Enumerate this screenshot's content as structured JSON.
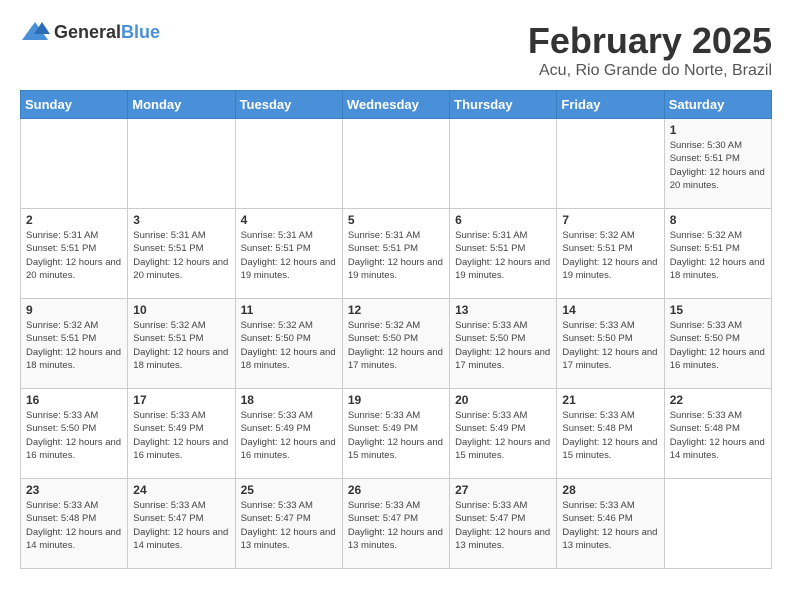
{
  "header": {
    "logo_general": "General",
    "logo_blue": "Blue",
    "title": "February 2025",
    "subtitle": "Acu, Rio Grande do Norte, Brazil"
  },
  "days_of_week": [
    "Sunday",
    "Monday",
    "Tuesday",
    "Wednesday",
    "Thursday",
    "Friday",
    "Saturday"
  ],
  "weeks": [
    [
      {
        "day": "",
        "info": ""
      },
      {
        "day": "",
        "info": ""
      },
      {
        "day": "",
        "info": ""
      },
      {
        "day": "",
        "info": ""
      },
      {
        "day": "",
        "info": ""
      },
      {
        "day": "",
        "info": ""
      },
      {
        "day": "1",
        "info": "Sunrise: 5:30 AM\nSunset: 5:51 PM\nDaylight: 12 hours and 20 minutes."
      }
    ],
    [
      {
        "day": "2",
        "info": "Sunrise: 5:31 AM\nSunset: 5:51 PM\nDaylight: 12 hours and 20 minutes."
      },
      {
        "day": "3",
        "info": "Sunrise: 5:31 AM\nSunset: 5:51 PM\nDaylight: 12 hours and 20 minutes."
      },
      {
        "day": "4",
        "info": "Sunrise: 5:31 AM\nSunset: 5:51 PM\nDaylight: 12 hours and 19 minutes."
      },
      {
        "day": "5",
        "info": "Sunrise: 5:31 AM\nSunset: 5:51 PM\nDaylight: 12 hours and 19 minutes."
      },
      {
        "day": "6",
        "info": "Sunrise: 5:31 AM\nSunset: 5:51 PM\nDaylight: 12 hours and 19 minutes."
      },
      {
        "day": "7",
        "info": "Sunrise: 5:32 AM\nSunset: 5:51 PM\nDaylight: 12 hours and 19 minutes."
      },
      {
        "day": "8",
        "info": "Sunrise: 5:32 AM\nSunset: 5:51 PM\nDaylight: 12 hours and 18 minutes."
      }
    ],
    [
      {
        "day": "9",
        "info": "Sunrise: 5:32 AM\nSunset: 5:51 PM\nDaylight: 12 hours and 18 minutes."
      },
      {
        "day": "10",
        "info": "Sunrise: 5:32 AM\nSunset: 5:51 PM\nDaylight: 12 hours and 18 minutes."
      },
      {
        "day": "11",
        "info": "Sunrise: 5:32 AM\nSunset: 5:50 PM\nDaylight: 12 hours and 18 minutes."
      },
      {
        "day": "12",
        "info": "Sunrise: 5:32 AM\nSunset: 5:50 PM\nDaylight: 12 hours and 17 minutes."
      },
      {
        "day": "13",
        "info": "Sunrise: 5:33 AM\nSunset: 5:50 PM\nDaylight: 12 hours and 17 minutes."
      },
      {
        "day": "14",
        "info": "Sunrise: 5:33 AM\nSunset: 5:50 PM\nDaylight: 12 hours and 17 minutes."
      },
      {
        "day": "15",
        "info": "Sunrise: 5:33 AM\nSunset: 5:50 PM\nDaylight: 12 hours and 16 minutes."
      }
    ],
    [
      {
        "day": "16",
        "info": "Sunrise: 5:33 AM\nSunset: 5:50 PM\nDaylight: 12 hours and 16 minutes."
      },
      {
        "day": "17",
        "info": "Sunrise: 5:33 AM\nSunset: 5:49 PM\nDaylight: 12 hours and 16 minutes."
      },
      {
        "day": "18",
        "info": "Sunrise: 5:33 AM\nSunset: 5:49 PM\nDaylight: 12 hours and 16 minutes."
      },
      {
        "day": "19",
        "info": "Sunrise: 5:33 AM\nSunset: 5:49 PM\nDaylight: 12 hours and 15 minutes."
      },
      {
        "day": "20",
        "info": "Sunrise: 5:33 AM\nSunset: 5:49 PM\nDaylight: 12 hours and 15 minutes."
      },
      {
        "day": "21",
        "info": "Sunrise: 5:33 AM\nSunset: 5:48 PM\nDaylight: 12 hours and 15 minutes."
      },
      {
        "day": "22",
        "info": "Sunrise: 5:33 AM\nSunset: 5:48 PM\nDaylight: 12 hours and 14 minutes."
      }
    ],
    [
      {
        "day": "23",
        "info": "Sunrise: 5:33 AM\nSunset: 5:48 PM\nDaylight: 12 hours and 14 minutes."
      },
      {
        "day": "24",
        "info": "Sunrise: 5:33 AM\nSunset: 5:47 PM\nDaylight: 12 hours and 14 minutes."
      },
      {
        "day": "25",
        "info": "Sunrise: 5:33 AM\nSunset: 5:47 PM\nDaylight: 12 hours and 13 minutes."
      },
      {
        "day": "26",
        "info": "Sunrise: 5:33 AM\nSunset: 5:47 PM\nDaylight: 12 hours and 13 minutes."
      },
      {
        "day": "27",
        "info": "Sunrise: 5:33 AM\nSunset: 5:47 PM\nDaylight: 12 hours and 13 minutes."
      },
      {
        "day": "28",
        "info": "Sunrise: 5:33 AM\nSunset: 5:46 PM\nDaylight: 12 hours and 13 minutes."
      },
      {
        "day": "",
        "info": ""
      }
    ]
  ]
}
